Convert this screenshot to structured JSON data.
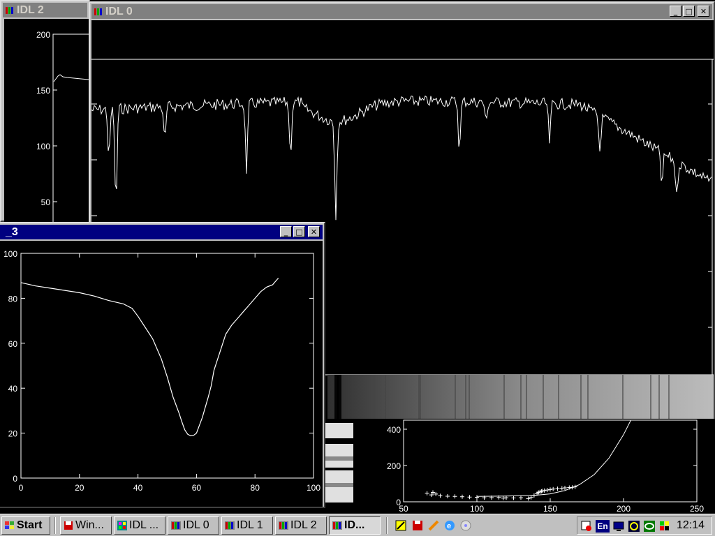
{
  "windows": {
    "idl2": {
      "title": "IDL 2",
      "yticks": [
        "200",
        "150",
        "100",
        "50"
      ]
    },
    "idl0": {
      "title": "IDL 0"
    },
    "idl3": {
      "title": "_3",
      "yticks": [
        "100",
        "80",
        "60",
        "40",
        "20",
        "0"
      ],
      "xticks": [
        "0",
        "20",
        "40",
        "60",
        "80",
        "100"
      ]
    },
    "fit_plot": {
      "yticks": [
        "400",
        "200",
        "0"
      ],
      "xticks": [
        "50",
        "100",
        "150",
        "200",
        "250"
      ]
    }
  },
  "chart_data": [
    {
      "type": "line",
      "name": "idl3_profile",
      "x": [
        0,
        5,
        10,
        15,
        20,
        25,
        30,
        35,
        38,
        40,
        42,
        45,
        48,
        50,
        52,
        54,
        55,
        56,
        57,
        58,
        59,
        60,
        62,
        64,
        65,
        66,
        68,
        70,
        72,
        74,
        76,
        78,
        80,
        82,
        84,
        86,
        88
      ],
      "y": [
        87,
        85.5,
        84.5,
        83.5,
        82.5,
        81,
        79,
        77.5,
        75.5,
        72,
        68,
        62,
        53,
        45,
        36,
        29,
        25,
        21.5,
        19.5,
        18.8,
        19,
        20,
        27,
        36,
        41,
        48,
        56,
        64,
        68,
        71,
        74,
        77,
        80,
        83,
        85,
        86,
        89
      ],
      "xlim": [
        0,
        100
      ],
      "ylim": [
        0,
        100
      ]
    },
    {
      "type": "scatter",
      "name": "fit_points",
      "x": [
        66,
        69,
        70,
        72,
        75,
        80,
        85,
        90,
        95,
        100,
        105,
        110,
        115,
        118,
        120,
        125,
        130,
        135,
        137,
        139,
        141,
        142,
        143,
        144,
        145,
        146,
        148,
        150,
        152,
        155,
        158,
        160,
        163,
        165,
        167
      ],
      "y": [
        47,
        38,
        52,
        43,
        33,
        31,
        30,
        28,
        26,
        25,
        22,
        23,
        24,
        20,
        22,
        21,
        22,
        18,
        24,
        35,
        45,
        52,
        55,
        58,
        60,
        62,
        65,
        68,
        70,
        72,
        75,
        77,
        79,
        80,
        82
      ],
      "xlim": [
        50,
        250
      ],
      "ylim": [
        0,
        450
      ]
    },
    {
      "type": "line",
      "name": "fit_curve",
      "x": [
        100,
        120,
        140,
        150,
        160,
        170,
        180,
        190,
        200,
        205
      ],
      "y": [
        30,
        32,
        36,
        44,
        62,
        95,
        150,
        240,
        370,
        450
      ]
    }
  ],
  "taskbar": {
    "start": "Start",
    "buttons": [
      "Win...",
      "IDL ...",
      "IDL 0",
      "IDL 1",
      "IDL 2",
      "ID..."
    ],
    "clock": "12:14",
    "lang": "En"
  },
  "icons": [
    "idl-icon",
    "minimize-icon",
    "maximize-icon",
    "close-icon",
    "floppy-icon",
    "palette-icon",
    "ie-icon",
    "cd-icon",
    "speaker-icon",
    "monitor-icon"
  ]
}
